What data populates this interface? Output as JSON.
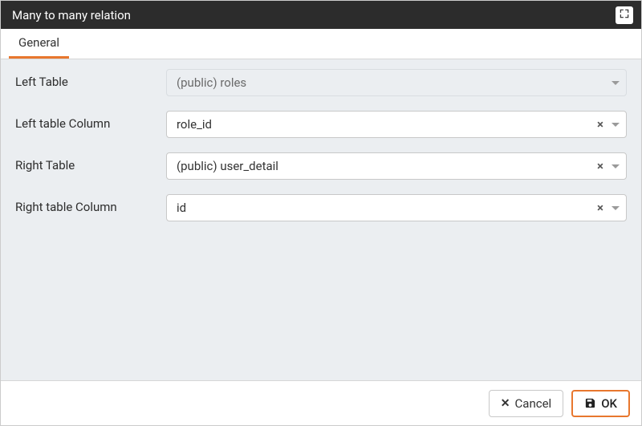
{
  "dialog": {
    "title": "Many to many relation"
  },
  "tabs": [
    {
      "label": "General",
      "active": true
    }
  ],
  "form": {
    "left_table": {
      "label": "Left Table",
      "value": "(public) roles",
      "readonly": true,
      "clearable": false
    },
    "left_table_column": {
      "label": "Left table Column",
      "value": "role_id",
      "readonly": false,
      "clearable": true
    },
    "right_table": {
      "label": "Right Table",
      "value": "(public) user_detail",
      "readonly": false,
      "clearable": true
    },
    "right_table_column": {
      "label": "Right table Column",
      "value": "id",
      "readonly": false,
      "clearable": true
    }
  },
  "buttons": {
    "cancel": "Cancel",
    "ok": "OK"
  }
}
